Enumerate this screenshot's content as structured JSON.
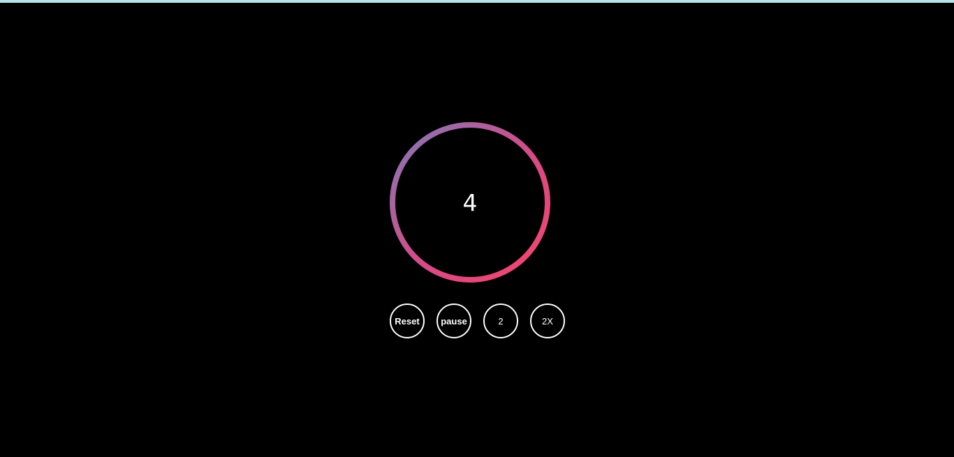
{
  "timer": {
    "count": "4",
    "ring_gradient_start": "#8a74b1",
    "ring_gradient_end": "#ee4670"
  },
  "controls": {
    "reset_label": "Reset",
    "pause_label": "pause",
    "two_label": "2",
    "speed_label": "2X"
  },
  "colors": {
    "background": "#000000",
    "top_strip": "#b9e3e6",
    "button_border": "#ffffff",
    "text": "#ffffff"
  }
}
